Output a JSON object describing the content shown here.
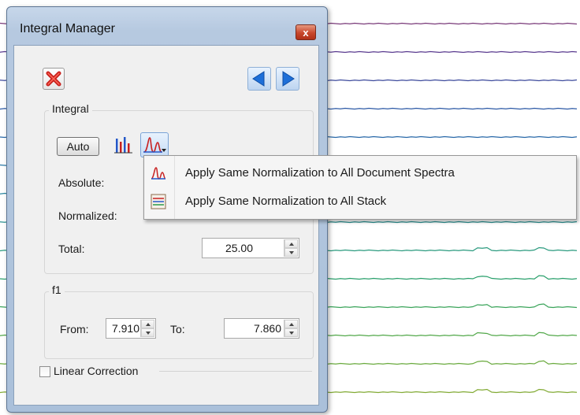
{
  "window": {
    "title": "Integral Manager",
    "close_symbol": "x"
  },
  "toolbar": {
    "delete_icon": "delete-icon",
    "prev_icon": "arrow-left-icon",
    "next_icon": "arrow-right-icon"
  },
  "integral": {
    "group_label": "Integral",
    "auto_label": "Auto",
    "absolute_label": "Absolute:",
    "normalized_label": "Normalized:",
    "total_label": "Total:",
    "total_value": "25.00"
  },
  "f1": {
    "group_label": "f1",
    "from_label": "From:",
    "from_value": "7.910",
    "to_label": "To:",
    "to_value": "7.860"
  },
  "linear_correction": {
    "label": "Linear Correction",
    "checked": false
  },
  "menu": {
    "items": [
      {
        "label": "Apply Same Normalization to All Document Spectra",
        "icon": "spectrum-peak-icon"
      },
      {
        "label": "Apply Same Normalization to All Stack",
        "icon": "stack-icon"
      }
    ]
  },
  "colors": {
    "spectra": [
      "#7a3b7a",
      "#5a3b8f",
      "#3d4a9c",
      "#2d5aa6",
      "#2868a8",
      "#2a78a6",
      "#2a86a0",
      "#2a9090",
      "#2a9a7e",
      "#2aa06c",
      "#3aa45a",
      "#52a84a",
      "#6aaa3e",
      "#82aa34"
    ]
  }
}
